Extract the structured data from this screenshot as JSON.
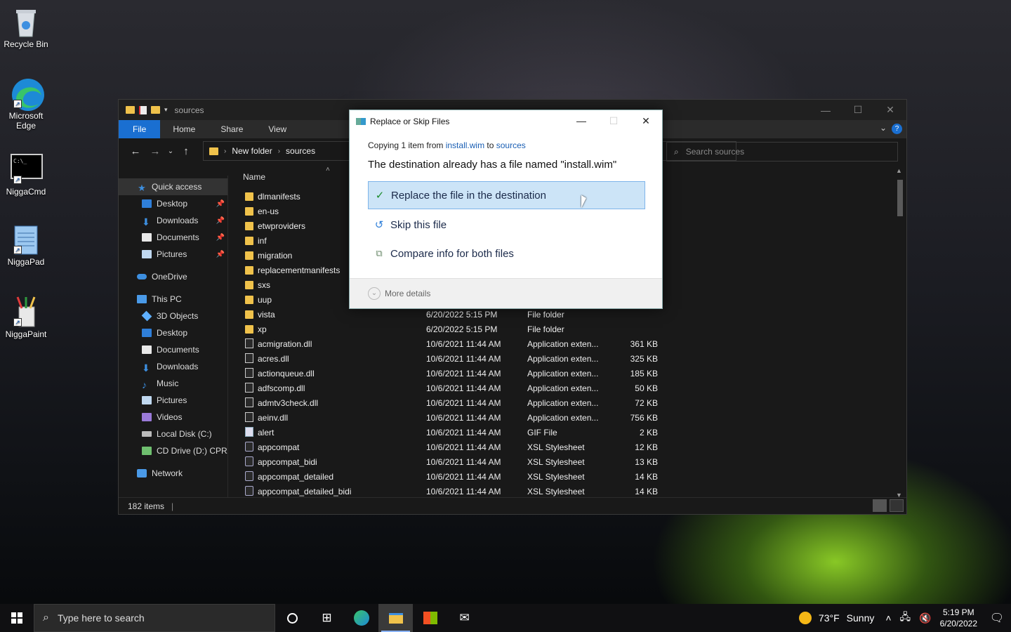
{
  "desktop": {
    "icons": [
      {
        "label": "Recycle Bin",
        "icon": "recycle-bin-icon"
      },
      {
        "label": "Microsoft Edge",
        "icon": "edge-icon"
      },
      {
        "label": "NiggaCmd",
        "icon": "cmd-icon"
      },
      {
        "label": "NiggaPad",
        "icon": "notepad-icon"
      },
      {
        "label": "NiggaPaint",
        "icon": "paint-icon"
      }
    ]
  },
  "explorer": {
    "title": "sources",
    "ribbon": {
      "file": "File",
      "home": "Home",
      "share": "Share",
      "view": "View"
    },
    "address": {
      "crumb1": "New folder",
      "crumb2": "sources"
    },
    "search_placeholder": "Search sources",
    "column_name": "Name",
    "nav": [
      {
        "label": "Quick access",
        "icon": "star-icon",
        "pinned": false,
        "indent": 1
      },
      {
        "label": "Desktop",
        "icon": "desktop-icon",
        "pinned": true,
        "indent": 2
      },
      {
        "label": "Downloads",
        "icon": "download-icon",
        "pinned": true,
        "indent": 2
      },
      {
        "label": "Documents",
        "icon": "documents-icon",
        "pinned": true,
        "indent": 2
      },
      {
        "label": "Pictures",
        "icon": "pictures-icon",
        "pinned": true,
        "indent": 2
      },
      {
        "label": "OneDrive",
        "icon": "cloud-icon",
        "pinned": false,
        "indent": 1
      },
      {
        "label": "This PC",
        "icon": "computer-icon",
        "pinned": false,
        "indent": 1
      },
      {
        "label": "3D Objects",
        "icon": "cube-icon",
        "pinned": false,
        "indent": 2
      },
      {
        "label": "Desktop",
        "icon": "desktop-icon",
        "pinned": false,
        "indent": 2
      },
      {
        "label": "Documents",
        "icon": "documents-icon",
        "pinned": false,
        "indent": 2
      },
      {
        "label": "Downloads",
        "icon": "download-icon",
        "pinned": false,
        "indent": 2
      },
      {
        "label": "Music",
        "icon": "music-icon",
        "pinned": false,
        "indent": 2
      },
      {
        "label": "Pictures",
        "icon": "pictures-icon",
        "pinned": false,
        "indent": 2
      },
      {
        "label": "Videos",
        "icon": "video-icon",
        "pinned": false,
        "indent": 2
      },
      {
        "label": "Local Disk (C:)",
        "icon": "disk-icon",
        "pinned": false,
        "indent": 2
      },
      {
        "label": "CD Drive (D:) CPRA",
        "icon": "cd-drive-icon",
        "pinned": false,
        "indent": 2
      },
      {
        "label": "Network",
        "icon": "network-icon",
        "pinned": false,
        "indent": 1
      }
    ],
    "files": [
      {
        "name": "dlmanifests",
        "date": "",
        "type": "",
        "size": "",
        "kind": "folder"
      },
      {
        "name": "en-us",
        "date": "",
        "type": "",
        "size": "",
        "kind": "folder"
      },
      {
        "name": "etwproviders",
        "date": "",
        "type": "",
        "size": "",
        "kind": "folder"
      },
      {
        "name": "inf",
        "date": "",
        "type": "",
        "size": "",
        "kind": "folder"
      },
      {
        "name": "migration",
        "date": "",
        "type": "",
        "size": "",
        "kind": "folder"
      },
      {
        "name": "replacementmanifests",
        "date": "",
        "type": "",
        "size": "",
        "kind": "folder"
      },
      {
        "name": "sxs",
        "date": "",
        "type": "",
        "size": "",
        "kind": "folder"
      },
      {
        "name": "uup",
        "date": "",
        "type": "",
        "size": "",
        "kind": "folder"
      },
      {
        "name": "vista",
        "date": "6/20/2022 5:15 PM",
        "type": "File folder",
        "size": "",
        "kind": "folder"
      },
      {
        "name": "xp",
        "date": "6/20/2022 5:15 PM",
        "type": "File folder",
        "size": "",
        "kind": "folder"
      },
      {
        "name": "acmigration.dll",
        "date": "10/6/2021 11:44 AM",
        "type": "Application exten...",
        "size": "361 KB",
        "kind": "dll"
      },
      {
        "name": "acres.dll",
        "date": "10/6/2021 11:44 AM",
        "type": "Application exten...",
        "size": "325 KB",
        "kind": "dll"
      },
      {
        "name": "actionqueue.dll",
        "date": "10/6/2021 11:44 AM",
        "type": "Application exten...",
        "size": "185 KB",
        "kind": "dll"
      },
      {
        "name": "adfscomp.dll",
        "date": "10/6/2021 11:44 AM",
        "type": "Application exten...",
        "size": "50 KB",
        "kind": "dll"
      },
      {
        "name": "admtv3check.dll",
        "date": "10/6/2021 11:44 AM",
        "type": "Application exten...",
        "size": "72 KB",
        "kind": "dll"
      },
      {
        "name": "aeinv.dll",
        "date": "10/6/2021 11:44 AM",
        "type": "Application exten...",
        "size": "756 KB",
        "kind": "dll"
      },
      {
        "name": "alert",
        "date": "10/6/2021 11:44 AM",
        "type": "GIF File",
        "size": "2 KB",
        "kind": "gif"
      },
      {
        "name": "appcompat",
        "date": "10/6/2021 11:44 AM",
        "type": "XSL Stylesheet",
        "size": "12 KB",
        "kind": "xsl"
      },
      {
        "name": "appcompat_bidi",
        "date": "10/6/2021 11:44 AM",
        "type": "XSL Stylesheet",
        "size": "13 KB",
        "kind": "xsl"
      },
      {
        "name": "appcompat_detailed",
        "date": "10/6/2021 11:44 AM",
        "type": "XSL Stylesheet",
        "size": "14 KB",
        "kind": "xsl"
      },
      {
        "name": "appcompat_detailed_bidi",
        "date": "10/6/2021 11:44 AM",
        "type": "XSL Stylesheet",
        "size": "14 KB",
        "kind": "xsl"
      }
    ],
    "status": "182 items"
  },
  "dialog": {
    "title": "Replace or Skip Files",
    "copy_prefix": "Copying 1 item from ",
    "copy_from": "install.wim",
    "copy_mid": " to ",
    "copy_to": "sources",
    "heading": "The destination already has a file named \"install.wim\"",
    "options": {
      "replace": "Replace the file in the destination",
      "skip": "Skip this file",
      "compare": "Compare info for both files"
    },
    "more_details": "More details"
  },
  "taskbar": {
    "search_placeholder": "Type here to search",
    "weather_temp": "73°F",
    "weather_text": "Sunny",
    "time": "5:19 PM",
    "date": "6/20/2022"
  }
}
